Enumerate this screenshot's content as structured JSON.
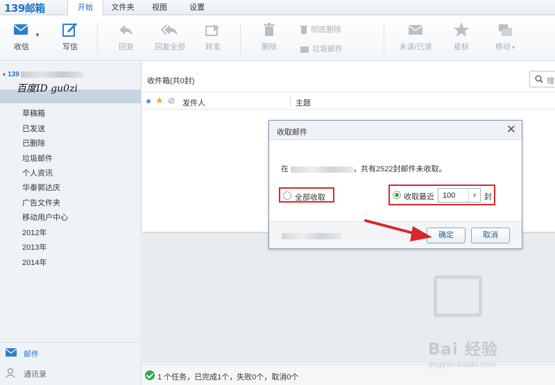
{
  "app": {
    "logo": "139邮箱"
  },
  "menu": {
    "tabs": [
      {
        "label": "开始",
        "active": true
      },
      {
        "label": "文件夹",
        "active": false
      },
      {
        "label": "视图",
        "active": false
      },
      {
        "label": "设置",
        "active": false
      }
    ]
  },
  "toolbar": {
    "receive": "收信",
    "compose": "写信",
    "reply": "回复",
    "reply_all": "回复全部",
    "forward": "转发",
    "delete": "删除",
    "purge": "彻底删除",
    "spam": "垃圾邮件",
    "read_status": "未读/已读",
    "star": "星标",
    "move": "移动"
  },
  "sidebar": {
    "account_prefix": "139",
    "watermark": "百度ID gu0zi",
    "folders": [
      "草稿箱",
      "已发送",
      "已删除",
      "垃圾邮件",
      "个人资讯",
      "华泰郭达庆",
      "广告文件夹",
      "移动用户中心",
      "2012年",
      "2013年",
      "2014年"
    ],
    "nav": {
      "mail": "邮件",
      "contacts": "通讯录"
    }
  },
  "main": {
    "inbox_title": "收件箱(共0封)",
    "search_placeholder": "搜",
    "col_sender": "发件人",
    "col_subject": "主题",
    "status_text": "1 个任务，已完成1个，失败0个，取消0个"
  },
  "dialog": {
    "title": "收取邮件",
    "msg_prefix": "在",
    "msg_suffix": "，共有2522封邮件未收取。",
    "option_all": "全部收取",
    "option_recent": "收取最近",
    "count_value": "100",
    "count_unit": "封",
    "ok": "确定",
    "cancel": "取消"
  },
  "watermark": {
    "brand": "Bai 经验",
    "url": "jingyan.baidu.com"
  },
  "colors": {
    "accent": "#1e73c8",
    "highlight_red": "#d9262c",
    "success": "#2fa84f"
  }
}
